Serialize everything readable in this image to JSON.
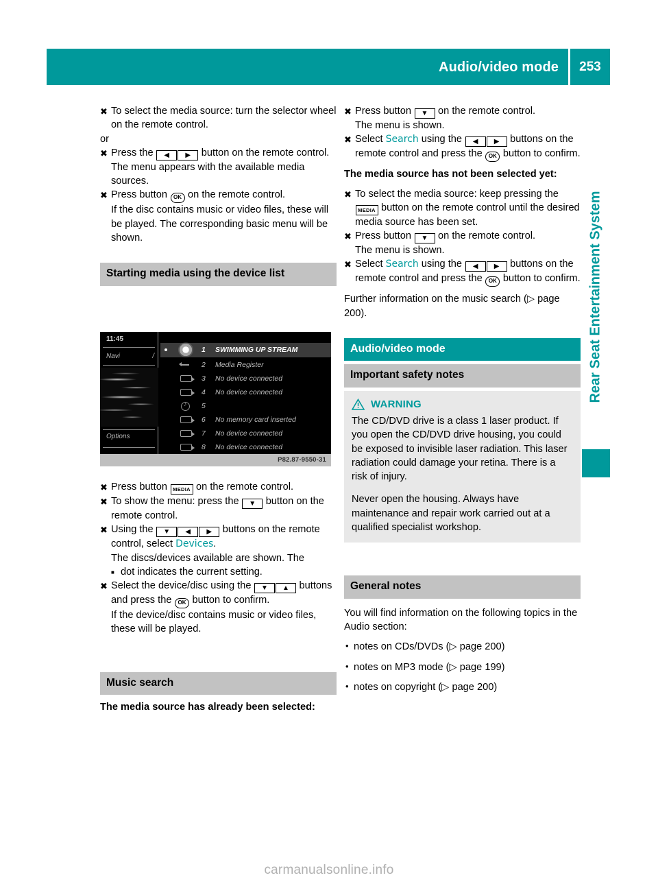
{
  "colors": {
    "teal": "#00999b",
    "gray_bar": "#c2c2c2",
    "warn_bg": "#e8e8e8"
  },
  "header": {
    "title": "Audio/video mode",
    "page_number": "253"
  },
  "side_tab": {
    "label": "Rear Seat Entertainment System"
  },
  "watermark": {
    "text": "carmanualsonline.info"
  },
  "left_column": {
    "steps_top": [
      {
        "marker": "X",
        "text": "To select the media source: turn the selector wheel on the remote control."
      },
      {
        "plain": "or"
      },
      {
        "marker": "X",
        "text_parts": [
          "Press the ",
          "[LEFT][RIGHT]",
          " button on the remote control."
        ]
      },
      {
        "cont": "The menu appears with the available media sources."
      },
      {
        "marker": "X",
        "text_parts": [
          "Press button ",
          "[OK]",
          " on the remote control."
        ]
      },
      {
        "cont": "If the disc contains music or video files, these will be played. The corresponding basic menu will be shown."
      }
    ],
    "section_heading": "Starting media using the device list",
    "figure": {
      "time": "11:45",
      "navi_label": "Navi",
      "options_label": "Options",
      "caption_code": "P82.87-9550-31",
      "rows": [
        {
          "num": "1",
          "label": "SWIMMING UP STREAM",
          "icon": "disc-icon",
          "selected": true,
          "dot": true
        },
        {
          "num": "2",
          "label": "Media Register",
          "icon": "usb-icon",
          "selected": false,
          "dot": false
        },
        {
          "num": "3",
          "label": "No device connected",
          "icon": "card-icon",
          "selected": false,
          "dot": false
        },
        {
          "num": "4",
          "label": "No device connected",
          "icon": "card-icon",
          "selected": false,
          "dot": false
        },
        {
          "num": "5",
          "label": "",
          "icon": "aux-icon",
          "selected": false,
          "dot": false
        },
        {
          "num": "6",
          "label": "No memory card inserted",
          "icon": "card-icon",
          "selected": false,
          "dot": false
        },
        {
          "num": "7",
          "label": "No device connected",
          "icon": "card-icon",
          "selected": false,
          "dot": false
        },
        {
          "num": "8",
          "label": "No device connected",
          "icon": "card-icon",
          "selected": false,
          "dot": false
        }
      ]
    },
    "steps_mid": [
      {
        "marker": "X",
        "text_parts": [
          "Press button ",
          "MEDIA",
          " on the remote control."
        ]
      },
      {
        "marker": "X",
        "text_parts": [
          "To show the menu: press the ",
          "[DOWN]",
          " button on the remote control."
        ]
      },
      {
        "marker": "X",
        "text_parts": [
          "Using the ",
          "[DOWN][LEFT][RIGHT]",
          " buttons on the remote control, select "
        ],
        "teal": "Devices",
        "tail": "."
      },
      {
        "cont": "The discs/devices available are shown. The"
      },
      {
        "square_bullet": "dot indicates the current setting."
      },
      {
        "marker": "X",
        "text_parts": [
          "Select the device/disc using the ",
          "[DOWN][UP]",
          " buttons and press the ",
          "[OK]",
          " button to confirm."
        ]
      },
      {
        "cont": "If the device/disc contains music or video files, these will be played."
      }
    ],
    "music_search_heading": "Music search",
    "music_search_sub": "The media source has already been selected:"
  },
  "right_column": {
    "steps_top": [
      {
        "marker": "X",
        "text_parts": [
          "Press button ",
          "[DOWN]",
          " on the remote control."
        ]
      },
      {
        "cont": "The menu is shown."
      },
      {
        "marker": "X",
        "pre": "Select ",
        "teal": "Search",
        "mid": " using the ",
        "keys": "[LEFT][RIGHT]",
        "post": " buttons on the remote control and press the ",
        "okpost": " button to confirm."
      }
    ],
    "subheading_not_selected": "The media source has not been selected yet:",
    "steps_not_selected": [
      {
        "marker": "X",
        "text_parts": [
          "To select the media source: keep pressing the ",
          "MEDIA",
          " button on the remote control until the desired media source has been set."
        ]
      },
      {
        "marker": "X",
        "text_parts": [
          "Press button ",
          "[DOWN]",
          " on the remote control."
        ]
      },
      {
        "cont": "The menu is shown."
      },
      {
        "marker": "X",
        "pre": "Select ",
        "teal": "Search",
        "mid": " using the ",
        "keys": "[LEFT][RIGHT]",
        "post": " buttons on the remote control and press the ",
        "okpost": " button to confirm."
      }
    ],
    "further_info": "Further information on the music search (▷ page 200).",
    "teal_heading": "Audio/video mode",
    "safety_heading": "Important safety notes",
    "warning": {
      "label": "WARNING",
      "paragraph_1": "The CD/DVD drive is a class 1 laser product. If you open the CD/DVD drive housing, you could be exposed to invisible laser radiation. This laser radiation could damage your retina. There is a risk of injury.",
      "paragraph_2": "Never open the housing. Always have maintenance and repair work carried out at a qualified specialist workshop."
    },
    "general_heading": "General notes",
    "general_intro": "You will find information on the following topics in the Audio section:",
    "general_bullets": [
      "notes on CDs/DVDs (▷ page 200)",
      "notes on MP3 mode (▷ page 199)",
      "notes on copyright (▷ page 200)"
    ]
  }
}
